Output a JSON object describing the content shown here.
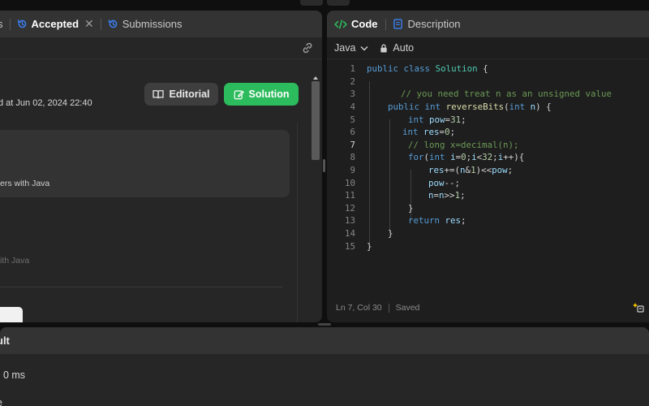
{
  "left_tabs": {
    "partial_prefix": "s",
    "accepted_label": "Accepted",
    "submissions_label": "Submissions"
  },
  "submission": {
    "submitted_text": "d at Jun 02, 2024 22:40",
    "editorial_label": "Editorial",
    "solution_label": "Solution",
    "stats_text": "ers with Java",
    "faded_text": "ith Java"
  },
  "right_tabs": {
    "code_label": "Code",
    "description_label": "Description"
  },
  "editor": {
    "language": "Java",
    "mode": "Auto",
    "status_position": "Ln 7, Col 30",
    "status_saved": "Saved",
    "current_line": 7
  },
  "code_lines": [
    {
      "n": "1"
    },
    {
      "n": "2"
    },
    {
      "n": "3"
    },
    {
      "n": "4"
    },
    {
      "n": "5"
    },
    {
      "n": "6"
    },
    {
      "n": "7"
    },
    {
      "n": "8"
    },
    {
      "n": "9"
    },
    {
      "n": "10"
    },
    {
      "n": "11"
    },
    {
      "n": "12"
    },
    {
      "n": "13"
    },
    {
      "n": "14"
    },
    {
      "n": "15"
    }
  ],
  "code_text": {
    "l1": [
      "public",
      "class",
      "Solution",
      "{"
    ],
    "l3": "// you need treat n as an unsigned value",
    "l4": [
      "public",
      "int",
      "reverseBits",
      "(",
      "int",
      "n",
      ") {"
    ],
    "l5": [
      "int",
      "pow",
      "=",
      "31",
      ";"
    ],
    "l6": [
      "int",
      "res",
      "=",
      "0",
      ";"
    ],
    "l7": "// long x=decimal(n);",
    "l8": [
      "for",
      "(",
      "int",
      "i",
      "=",
      "0",
      ";",
      "i",
      "<",
      "32",
      ";",
      "i",
      "++){"
    ],
    "l9": [
      "res",
      "+=(",
      "n",
      "&",
      "1",
      ")<<",
      "pow",
      ";"
    ],
    "l10": [
      "pow",
      "--;"
    ],
    "l11": [
      "n",
      "=",
      "n",
      ">>",
      "1",
      ";"
    ],
    "l12": "}",
    "l13": [
      "return",
      "res",
      ";"
    ],
    "l14": "}",
    "l15": "}"
  },
  "bottom": {
    "title": "ult",
    "runtime": ": 0 ms",
    "more": "e"
  },
  "colors": {
    "accent_green": "#2cbb5d",
    "accepted_blue": "#3b82f6",
    "code_icon_green": "#2cbb5d",
    "description_icon_blue": "#3b82f6"
  }
}
